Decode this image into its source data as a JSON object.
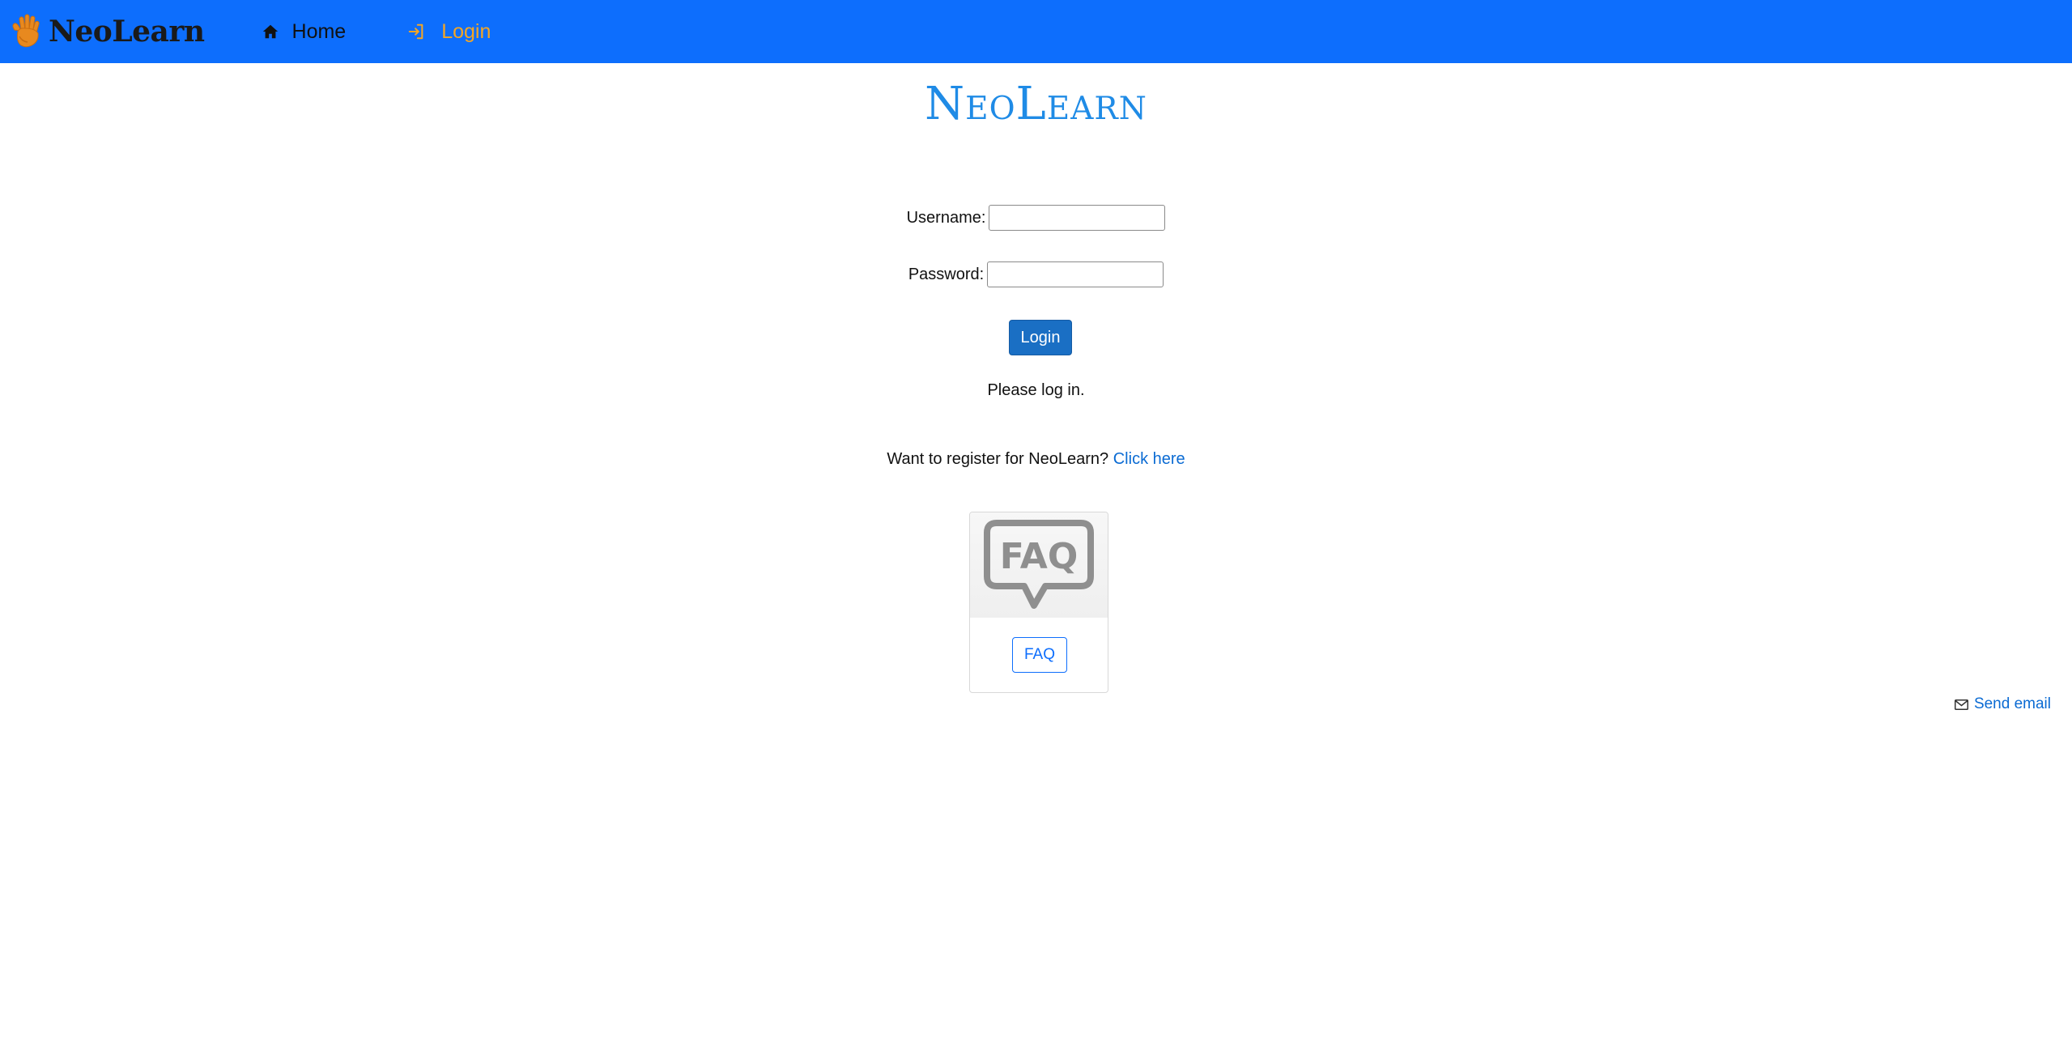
{
  "navbar": {
    "brand": "NeoLearn",
    "brand_icon": "hand-logo-icon",
    "bg_color": "#0d6efd",
    "items": [
      {
        "label": "Home",
        "icon": "home-icon"
      },
      {
        "label": "Login",
        "icon": "login-icon",
        "color": "#f5a623"
      }
    ]
  },
  "main": {
    "title": "NeoLearn",
    "form": {
      "username_label": "Username:",
      "username_value": "",
      "password_label": "Password:",
      "password_value": "",
      "submit_label": "Login"
    },
    "status": "Please log in.",
    "register": {
      "text": "Want to register for NeoLearn?",
      "link": "Click here"
    },
    "faq_card": {
      "image_text": "FAQ",
      "button_label": "FAQ"
    }
  },
  "footer": {
    "send_email": "Send email",
    "send_email_icon": "envelope-icon"
  },
  "colors": {
    "accent": "#0d6efd",
    "title": "#1f8be6",
    "login_button": "#1a6fc4",
    "link": "#0b6bd3",
    "nav_active": "#f5a623"
  }
}
